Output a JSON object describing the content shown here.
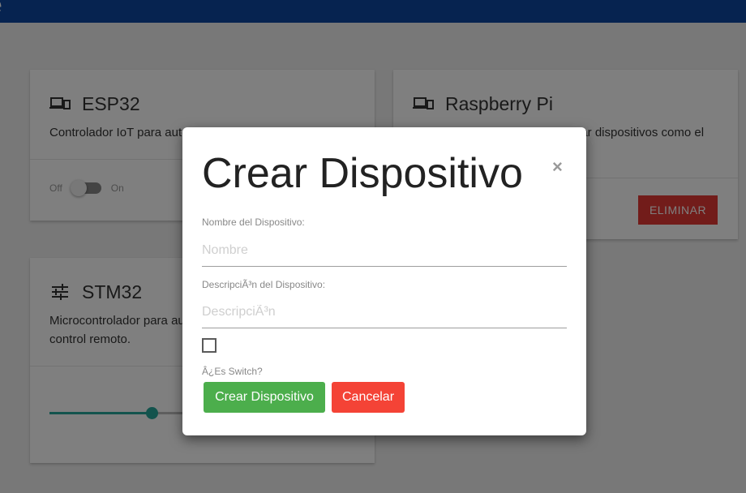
{
  "appbar": {
    "title": "e"
  },
  "cards": {
    "esp": {
      "icon": "devices-icon",
      "title": "ESP32",
      "description": "Controlador IoT para automatizar dispositivos",
      "switch_off": "Off",
      "switch_on": "On",
      "switch_state": false
    },
    "rpi": {
      "icon": "devices-icon",
      "title": "Raspberry Pi",
      "description": "Controlador IoT para automatizar dispositivos como el aire acondicionado",
      "delete_label": "ELIMINAR"
    },
    "stm": {
      "icon": "tune-icon",
      "title": "STM32",
      "description": "Microcontrolador para automatizar dispositivos mediante control remoto.",
      "slider_value": 0.34
    }
  },
  "modal": {
    "title": "Crear Dispositivo",
    "close_label": "×",
    "name_label": "Nombre del Dispositivo:",
    "name_placeholder": "Nombre",
    "name_value": "",
    "desc_label": "DescripciÃ³n del Dispositivo:",
    "desc_placeholder": "DescripciÃ³n",
    "desc_value": "",
    "switch_checkbox_checked": false,
    "switch_label": "Â¿Es Switch?",
    "create_label": "Crear Dispositivo",
    "cancel_label": "Cancelar"
  },
  "colors": {
    "appbar": "#0d47a1",
    "teal": "#26a69a",
    "danger": "#e53935",
    "success": "#4cae4c",
    "cancel": "#f44336"
  }
}
